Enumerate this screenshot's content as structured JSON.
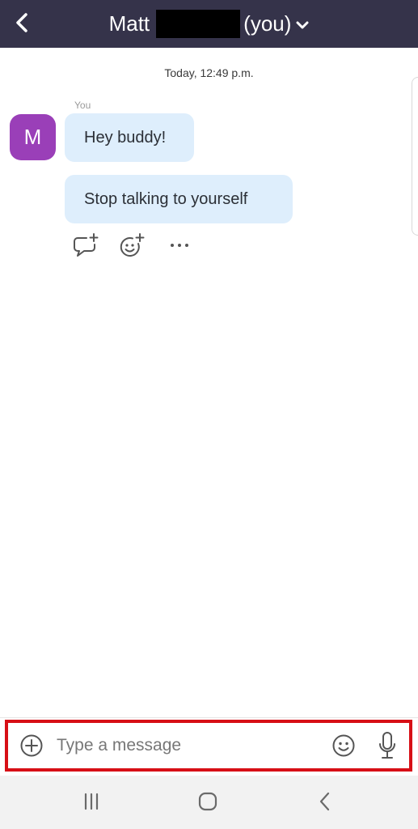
{
  "header": {
    "title_name": "Matt",
    "title_suffix": "(you)",
    "back_icon": "chevron-left-icon",
    "dropdown_icon": "chevron-down-icon",
    "background_color": "#35334a"
  },
  "conversation": {
    "timestamp": "Today, 12:49 p.m.",
    "sender_label": "You",
    "avatar": {
      "initial": "M",
      "color": "#9a3fb8"
    },
    "messages": [
      {
        "text": "Hey buddy!"
      },
      {
        "text": "Stop talking to yourself"
      }
    ],
    "message_actions": [
      {
        "name": "reply-thread",
        "icon": "comment-plus-icon"
      },
      {
        "name": "add-reaction",
        "icon": "emoji-plus-icon"
      },
      {
        "name": "more-options",
        "icon": "more-horizontal-icon"
      }
    ],
    "bubble_color": "#deeefc"
  },
  "composer": {
    "placeholder": "Type a message",
    "value": "",
    "add_icon": "plus-circle-icon",
    "emoji_icon": "emoji-icon",
    "mic_icon": "microphone-icon",
    "highlight_color": "#d70f16"
  },
  "system_nav": {
    "recents_icon": "recents-icon",
    "home_icon": "home-icon",
    "back_icon": "back-icon"
  }
}
